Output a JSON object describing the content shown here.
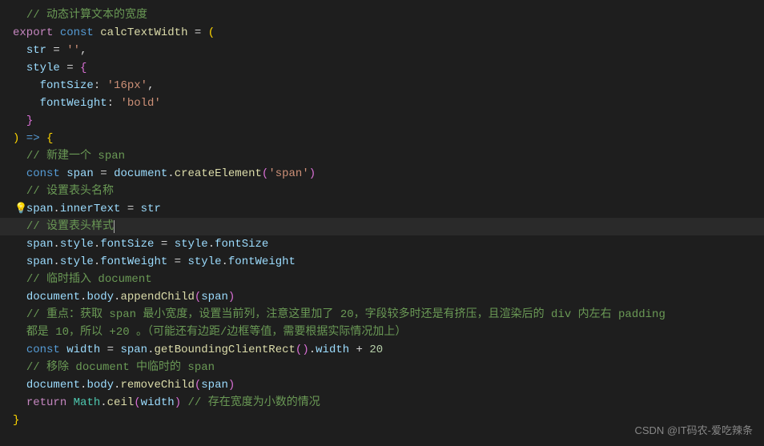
{
  "code": {
    "l1_comment": "// 动态计算文本的宽度",
    "l2_export": "export",
    "l2_const": "const",
    "l2_fn": "calcTextWidth",
    "l2_eq": " = ",
    "l2_paren_open": "(",
    "l3_str": "str",
    "l3_eq": " = ",
    "l3_val": "''",
    "l3_comma": ",",
    "l4_style": "style",
    "l4_eq": " = ",
    "l4_brace": "{",
    "l5_key": "fontSize",
    "l5_colon": ": ",
    "l5_val": "'16px'",
    "l5_comma": ",",
    "l6_key": "fontWeight",
    "l6_colon": ": ",
    "l6_val": "'bold'",
    "l7_brace": "}",
    "l8_paren": ")",
    "l8_arrow": " => ",
    "l8_brace": "{",
    "l9_comment": "// 新建一个 span",
    "l10_const": "const",
    "l10_span": " span",
    "l10_eq": " = ",
    "l10_doc": "document",
    "l10_dot": ".",
    "l10_fn": "createElement",
    "l10_p1": "(",
    "l10_arg": "'span'",
    "l10_p2": ")",
    "l11_comment": "// 设置表头名称",
    "l12_span": "span",
    "l12_dot": ".",
    "l12_prop": "innerText",
    "l12_eq": " = ",
    "l12_val": "str",
    "l13_comment": "// 设置表头样式",
    "l14_span": "span",
    "l14_d1": ".",
    "l14_style": "style",
    "l14_d2": ".",
    "l14_prop": "fontSize",
    "l14_eq": " = ",
    "l14_rstyle": "style",
    "l14_d3": ".",
    "l14_rprop": "fontSize",
    "l15_span": "span",
    "l15_d1": ".",
    "l15_style": "style",
    "l15_d2": ".",
    "l15_prop": "fontWeight",
    "l15_eq": " = ",
    "l15_rstyle": "style",
    "l15_d3": ".",
    "l15_rprop": "fontWeight",
    "l16_comment": "// 临时插入 document",
    "l17_doc": "document",
    "l17_d1": ".",
    "l17_body": "body",
    "l17_d2": ".",
    "l17_fn": "appendChild",
    "l17_p1": "(",
    "l17_arg": "span",
    "l17_p2": ")",
    "l18_comment": "// 重点：获取 span 最小宽度，设置当前列，注意这里加了 20，字段较多时还是有挤压，且渲染后的 div 内左右 padding",
    "l19_comment": "都是 10，所以 +20 。（可能还有边距/边框等值，需要根据实际情况加上）",
    "l20_const": "const",
    "l20_width": " width",
    "l20_eq": " = ",
    "l20_span": "span",
    "l20_d1": ".",
    "l20_fn": "getBoundingClientRect",
    "l20_p1": "(",
    "l20_p2": ")",
    "l20_d2": ".",
    "l20_prop": "width",
    "l20_plus": " + ",
    "l20_num": "20",
    "l21_comment": "// 移除 document 中临时的 span",
    "l22_doc": "document",
    "l22_d1": ".",
    "l22_body": "body",
    "l22_d2": ".",
    "l22_fn": "removeChild",
    "l22_p1": "(",
    "l22_arg": "span",
    "l22_p2": ")",
    "l23_return": "return",
    "l23_math": " Math",
    "l23_d1": ".",
    "l23_fn": "ceil",
    "l23_p1": "(",
    "l23_arg": "width",
    "l23_p2": ")",
    "l23_sp": " ",
    "l23_comment": "// 存在宽度为小数的情况",
    "l24_brace": "}"
  },
  "watermark": "CSDN @IT码农-爱吃辣条"
}
